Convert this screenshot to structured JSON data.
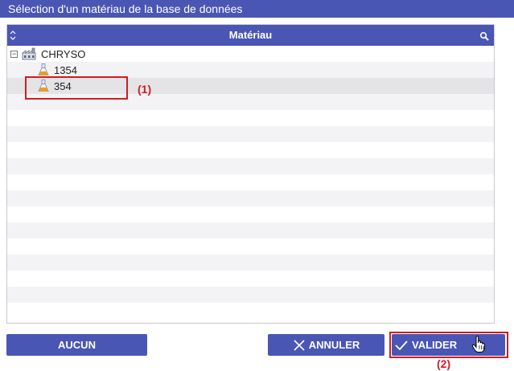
{
  "dialog": {
    "title": "Sélection d'un matériau de la base de données"
  },
  "grid": {
    "header": {
      "title": "Matériau"
    },
    "tree": {
      "root": {
        "label": "CHRYSO",
        "toggle": "−",
        "icon": "factory-icon"
      },
      "children": [
        {
          "label": "1354",
          "icon": "flask-icon"
        },
        {
          "label": "354",
          "icon": "flask-icon",
          "selected": true
        }
      ]
    }
  },
  "annotations": {
    "step1": "(1)",
    "step2": "(2)"
  },
  "buttons": {
    "none_label": "AUCUN",
    "cancel_label": "ANNULER",
    "validate_label": "VALIDER"
  },
  "colors": {
    "primary": "#4a56b3",
    "annotation": "#d01c24",
    "selected_row": "#e4e4e6"
  }
}
